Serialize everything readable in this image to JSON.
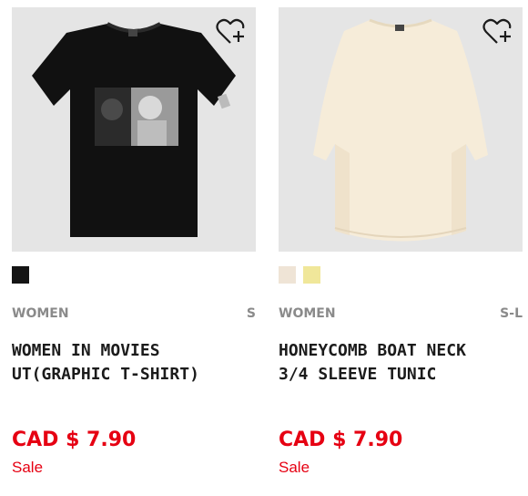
{
  "products": [
    {
      "category": "WOMEN",
      "sizes": "S",
      "name_line1": "WOMEN IN MOVIES",
      "name_line2": "UT(GRAPHIC T-SHIRT)",
      "price": "CAD $ 7.90",
      "sale": "Sale",
      "image_bg": "#e5e5e5",
      "swatches": [
        "#151515"
      ]
    },
    {
      "category": "WOMEN",
      "sizes": "S-L",
      "name_line1": "HONEYCOMB BOAT NECK",
      "name_line2": "3/4 SLEEVE TUNIC",
      "price": "CAD $ 7.90",
      "sale": "Sale",
      "image_bg": "#e5e5e5",
      "swatches": [
        "#efe4d6",
        "#f0e79a"
      ]
    }
  ],
  "icons": {
    "wishlist": "heart-plus-icon"
  },
  "colors": {
    "price": "#e60012",
    "meta": "#8a8a8a",
    "text": "#1b1b1b"
  }
}
